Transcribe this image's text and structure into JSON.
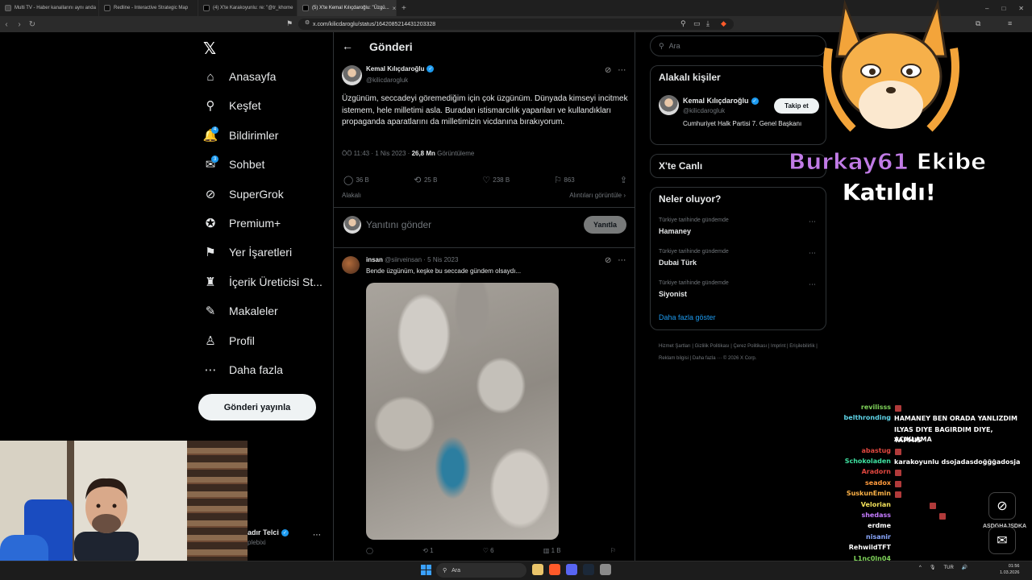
{
  "browser": {
    "tabs": [
      {
        "label": "Multi TV - Haber kanallarını aynı anda",
        "color": "#444",
        "active": false
      },
      {
        "label": "Redline - Interactive Strategic Map",
        "color": "#111",
        "active": false
      },
      {
        "label": "(4) X'te Karakoyunlu: re: \"@tr_khome",
        "color": "#000",
        "active": false
      },
      {
        "label": "(5) X'te Kemal Kılıçdaroğlu: \"Üzgü...",
        "color": "#000",
        "active": true
      }
    ],
    "new_tab": "+",
    "url": "x.com/kilicdaroglu/status/1642085214431203328"
  },
  "nav": {
    "logo": "𝕏",
    "items": [
      {
        "label": "Anasayfa",
        "icon": "⌂",
        "name": "home",
        "badge": ""
      },
      {
        "label": "Keşfet",
        "icon": "⚲",
        "name": "explore",
        "badge": ""
      },
      {
        "label": "Bildirimler",
        "icon": "🔔",
        "name": "notifications",
        "badge": "4"
      },
      {
        "label": "Sohbet",
        "icon": "✉",
        "name": "chat",
        "badge": "3"
      },
      {
        "label": "SuperGrok",
        "icon": "⊘",
        "name": "supergrok",
        "badge": ""
      },
      {
        "label": "Premium+",
        "icon": "✪",
        "name": "premium",
        "badge": ""
      },
      {
        "label": "Yer İşaretleri",
        "icon": "⚑",
        "name": "bookmarks",
        "badge": ""
      },
      {
        "label": "İçerik Üreticisi St...",
        "icon": "♜",
        "name": "creator-studio",
        "badge": ""
      },
      {
        "label": "Makaleler",
        "icon": "✎",
        "name": "articles",
        "badge": ""
      },
      {
        "label": "Profil",
        "icon": "♙",
        "name": "profile",
        "badge": ""
      },
      {
        "label": "Daha fazla",
        "icon": "⋯",
        "name": "more",
        "badge": ""
      }
    ],
    "post_button": "Gönderi yayınla",
    "account_name": "adır Telci",
    "account_handle": "plebixi"
  },
  "header": {
    "back": "←",
    "title": "Gönderi"
  },
  "tweet": {
    "author": "Kemal Kılıçdaroğlu",
    "handle": "@kilicdarogluk",
    "text": "Üzgünüm, seccadeyi göremediğim için çok üzgünüm. Dünyada kimseyi incitmek istemem, hele milletimi asla. Buradan istismarcılık yapanları ve kullandıkları propaganda aparatlarını da milletimizin vicdanına bırakıyorum.",
    "time": "ÖÖ 11:43 · 1 Nis 2023 · ",
    "views": "26,8 Mn",
    "views_label": " Görüntüleme",
    "replies": "36 B",
    "retweets": "25 B",
    "likes": "238 B",
    "bookmarks": "863",
    "related_label": "Alakalı",
    "quotes_label": "Alıntıları görüntüle ›",
    "reply_placeholder": "Yanıtını gönder",
    "reply_button": "Yanıtla"
  },
  "reply1": {
    "name": "insan",
    "meta": " @siirveinsan · 5 Nis 2023",
    "text": "Bende üzgünüm, keşke bu seccade gündem olsaydı...",
    "replies": "",
    "retweets": "1",
    "likes": "6",
    "views": "1 B"
  },
  "right": {
    "search_placeholder": "Ara",
    "related_title": "Alakalı kişiler",
    "related_person": {
      "name": "Kemal Kılıçdaroğlu",
      "handle": "@kilicdarogluk",
      "bio": "Cumhuriyet Halk Partisi 7. Genel Başkanı",
      "follow": "Takip et"
    },
    "live_title": "X'te Canlı",
    "trends_title": "Neler oluyor?",
    "trends": [
      {
        "context": "Türkiye tarihinde gündemde",
        "name": "Hamaney"
      },
      {
        "context": "Türkiye tarihinde gündemde",
        "name": "Dubai Türk"
      },
      {
        "context": "Türkiye tarihinde gündemde",
        "name": "Siyonist"
      }
    ],
    "show_more": "Daha fazla göster",
    "footer": "Hizmet Şartları  |  Gizlilik Politikası  |  Çerez Politikası  |  Imprint  |  Erişilebilirlik  |  Reklam bilgisi  |  Daha fazla ···  © 2026 X Corp."
  },
  "overlay": {
    "alert_name": "Burkay61",
    "alert_rest": " Ekibe",
    "alert_line2": "Katıldı!",
    "chat": [
      {
        "user": "revilisss",
        "color": "#7fd35a",
        "msg": ""
      },
      {
        "user": "belthronding",
        "color": "#5ed3e6",
        "msg": "HAMANEY BEN ORADA YANLIZDIM"
      },
      {
        "user": "",
        "color": "#ffffff",
        "msg": "ILYAS DIYE BAGIRDIM DIYE, ACIKLAMA"
      },
      {
        "user": "",
        "color": "#ffffff",
        "msg": "YAPMIS"
      },
      {
        "user": "abastug",
        "color": "#e0473f",
        "msg": ""
      },
      {
        "user": "Schokoladen",
        "color": "#3ee0a0",
        "msg": "karakoyunlu dsojadasdoğğğadosja"
      },
      {
        "user": "Aradorn",
        "color": "#e0473f",
        "msg": ""
      },
      {
        "user": "seadox",
        "color": "#ff9a3c",
        "msg": ""
      },
      {
        "user": "SuskunEmin",
        "color": "#ffb347",
        "msg": ""
      },
      {
        "user": "Velorian",
        "color": "#f1e05a",
        "msg": ""
      },
      {
        "user": "shedass",
        "color": "#c57bff",
        "msg": ""
      },
      {
        "user": "erdme",
        "color": "#ffffff",
        "msg": ""
      },
      {
        "user": "nisanir",
        "color": "#8aa8ff",
        "msg": ""
      },
      {
        "user": "RehwildTFT",
        "color": "#ffffff",
        "msg": ""
      },
      {
        "user": "L1nc0ln04",
        "color": "#7fd35a",
        "msg": ""
      }
    ],
    "side_text": "ASDGHAJSDKA"
  },
  "taskbar": {
    "search": "Ara",
    "lang": "TUR",
    "time": "01:56",
    "date": "1.03.2026"
  }
}
